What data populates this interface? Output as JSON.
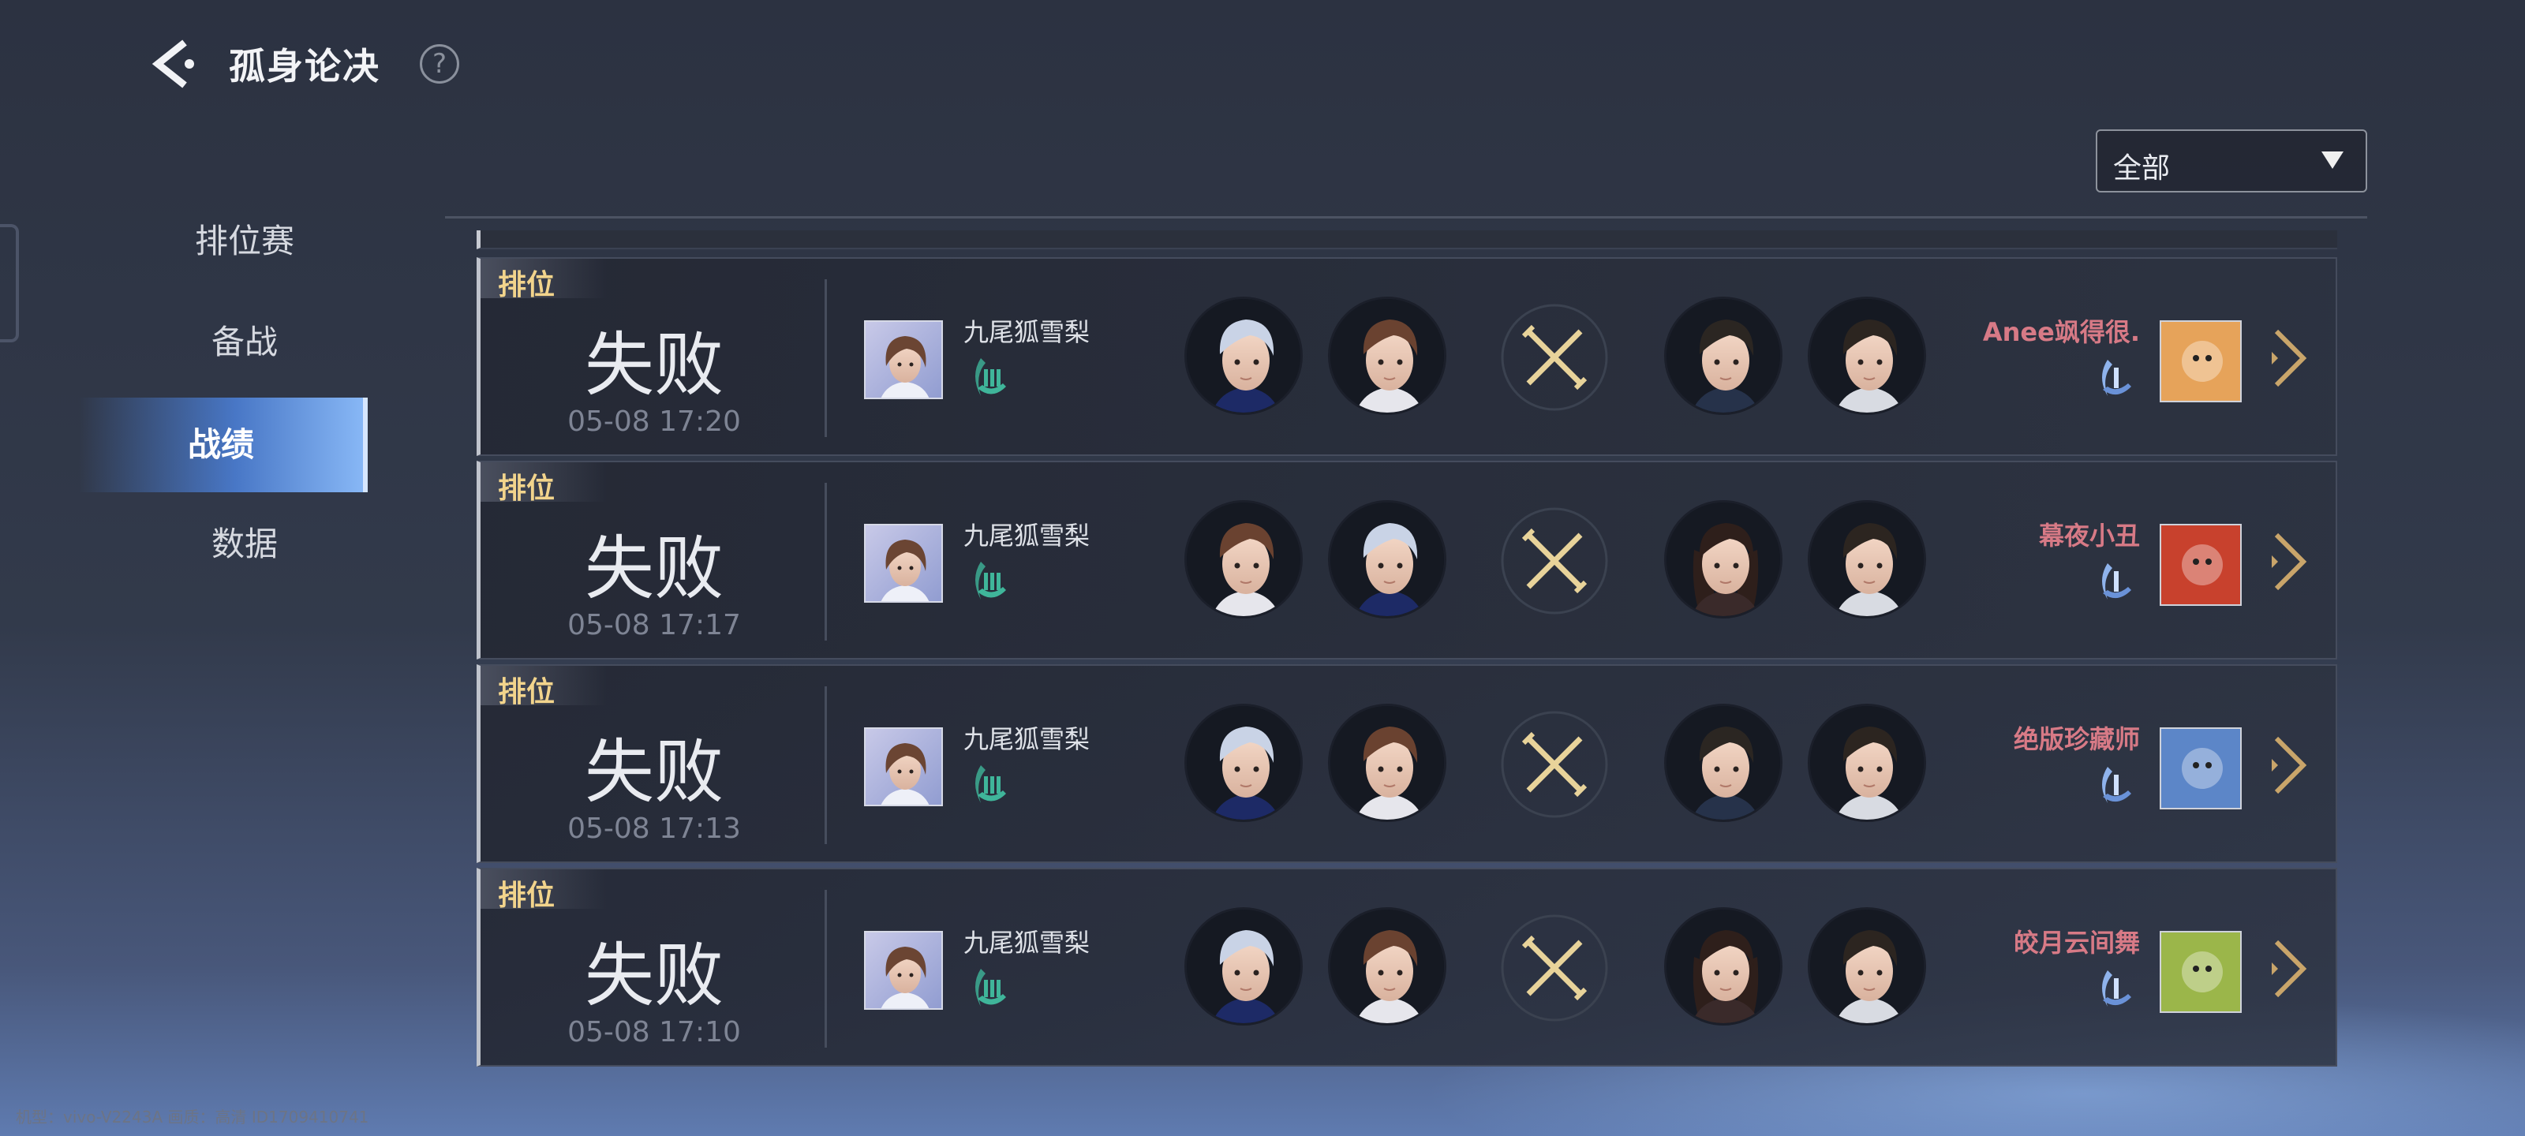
{
  "header": {
    "title": "孤身论决",
    "help": "?"
  },
  "filter": {
    "value": "全部"
  },
  "sidebar": {
    "items": [
      {
        "label": "排位赛"
      },
      {
        "label": "备战"
      },
      {
        "label": "战绩",
        "active": true
      },
      {
        "label": "数据"
      }
    ]
  },
  "matches": [
    {
      "badge": "排位",
      "result": "失败",
      "time": "05-08 17:20",
      "player_name": "九尾狐雪梨",
      "opponent_name": "Anee飒得很.",
      "my_heroes": [
        "silver-hair-hero",
        "brown-hair-girl-hero"
      ],
      "opp_heroes": [
        "dark-hair-hero",
        "dark-hair-boy-hero"
      ]
    },
    {
      "badge": "排位",
      "result": "失败",
      "time": "05-08 17:17",
      "player_name": "九尾狐雪梨",
      "opponent_name": "幕夜小丑",
      "my_heroes": [
        "brown-hair-girl-hero",
        "silver-hair-hero"
      ],
      "opp_heroes": [
        "long-hair-girl-hero",
        "dark-hair-boy-hero"
      ]
    },
    {
      "badge": "排位",
      "result": "失败",
      "time": "05-08 17:13",
      "player_name": "九尾狐雪梨",
      "opponent_name": "绝版珍藏师",
      "my_heroes": [
        "silver-hair-hero",
        "brown-hair-girl-hero"
      ],
      "opp_heroes": [
        "dark-hair-hero",
        "dark-hair-boy-hero"
      ]
    },
    {
      "badge": "排位",
      "result": "失败",
      "time": "05-08 17:10",
      "player_name": "九尾狐雪梨",
      "opponent_name": "皎月云间舞",
      "my_heroes": [
        "silver-hair-hero",
        "brown-hair-girl-hero"
      ],
      "opp_heroes": [
        "long-hair-girl-hero",
        "dark-hair-boy-hero"
      ]
    }
  ],
  "footer": {
    "device_info": "机型：vivo-V2243A 画质：高清 ID1709410741"
  },
  "colors": {
    "accent": "#5a8ef0",
    "opponent_name": "#d77a86",
    "badge": "#f2d48c"
  }
}
